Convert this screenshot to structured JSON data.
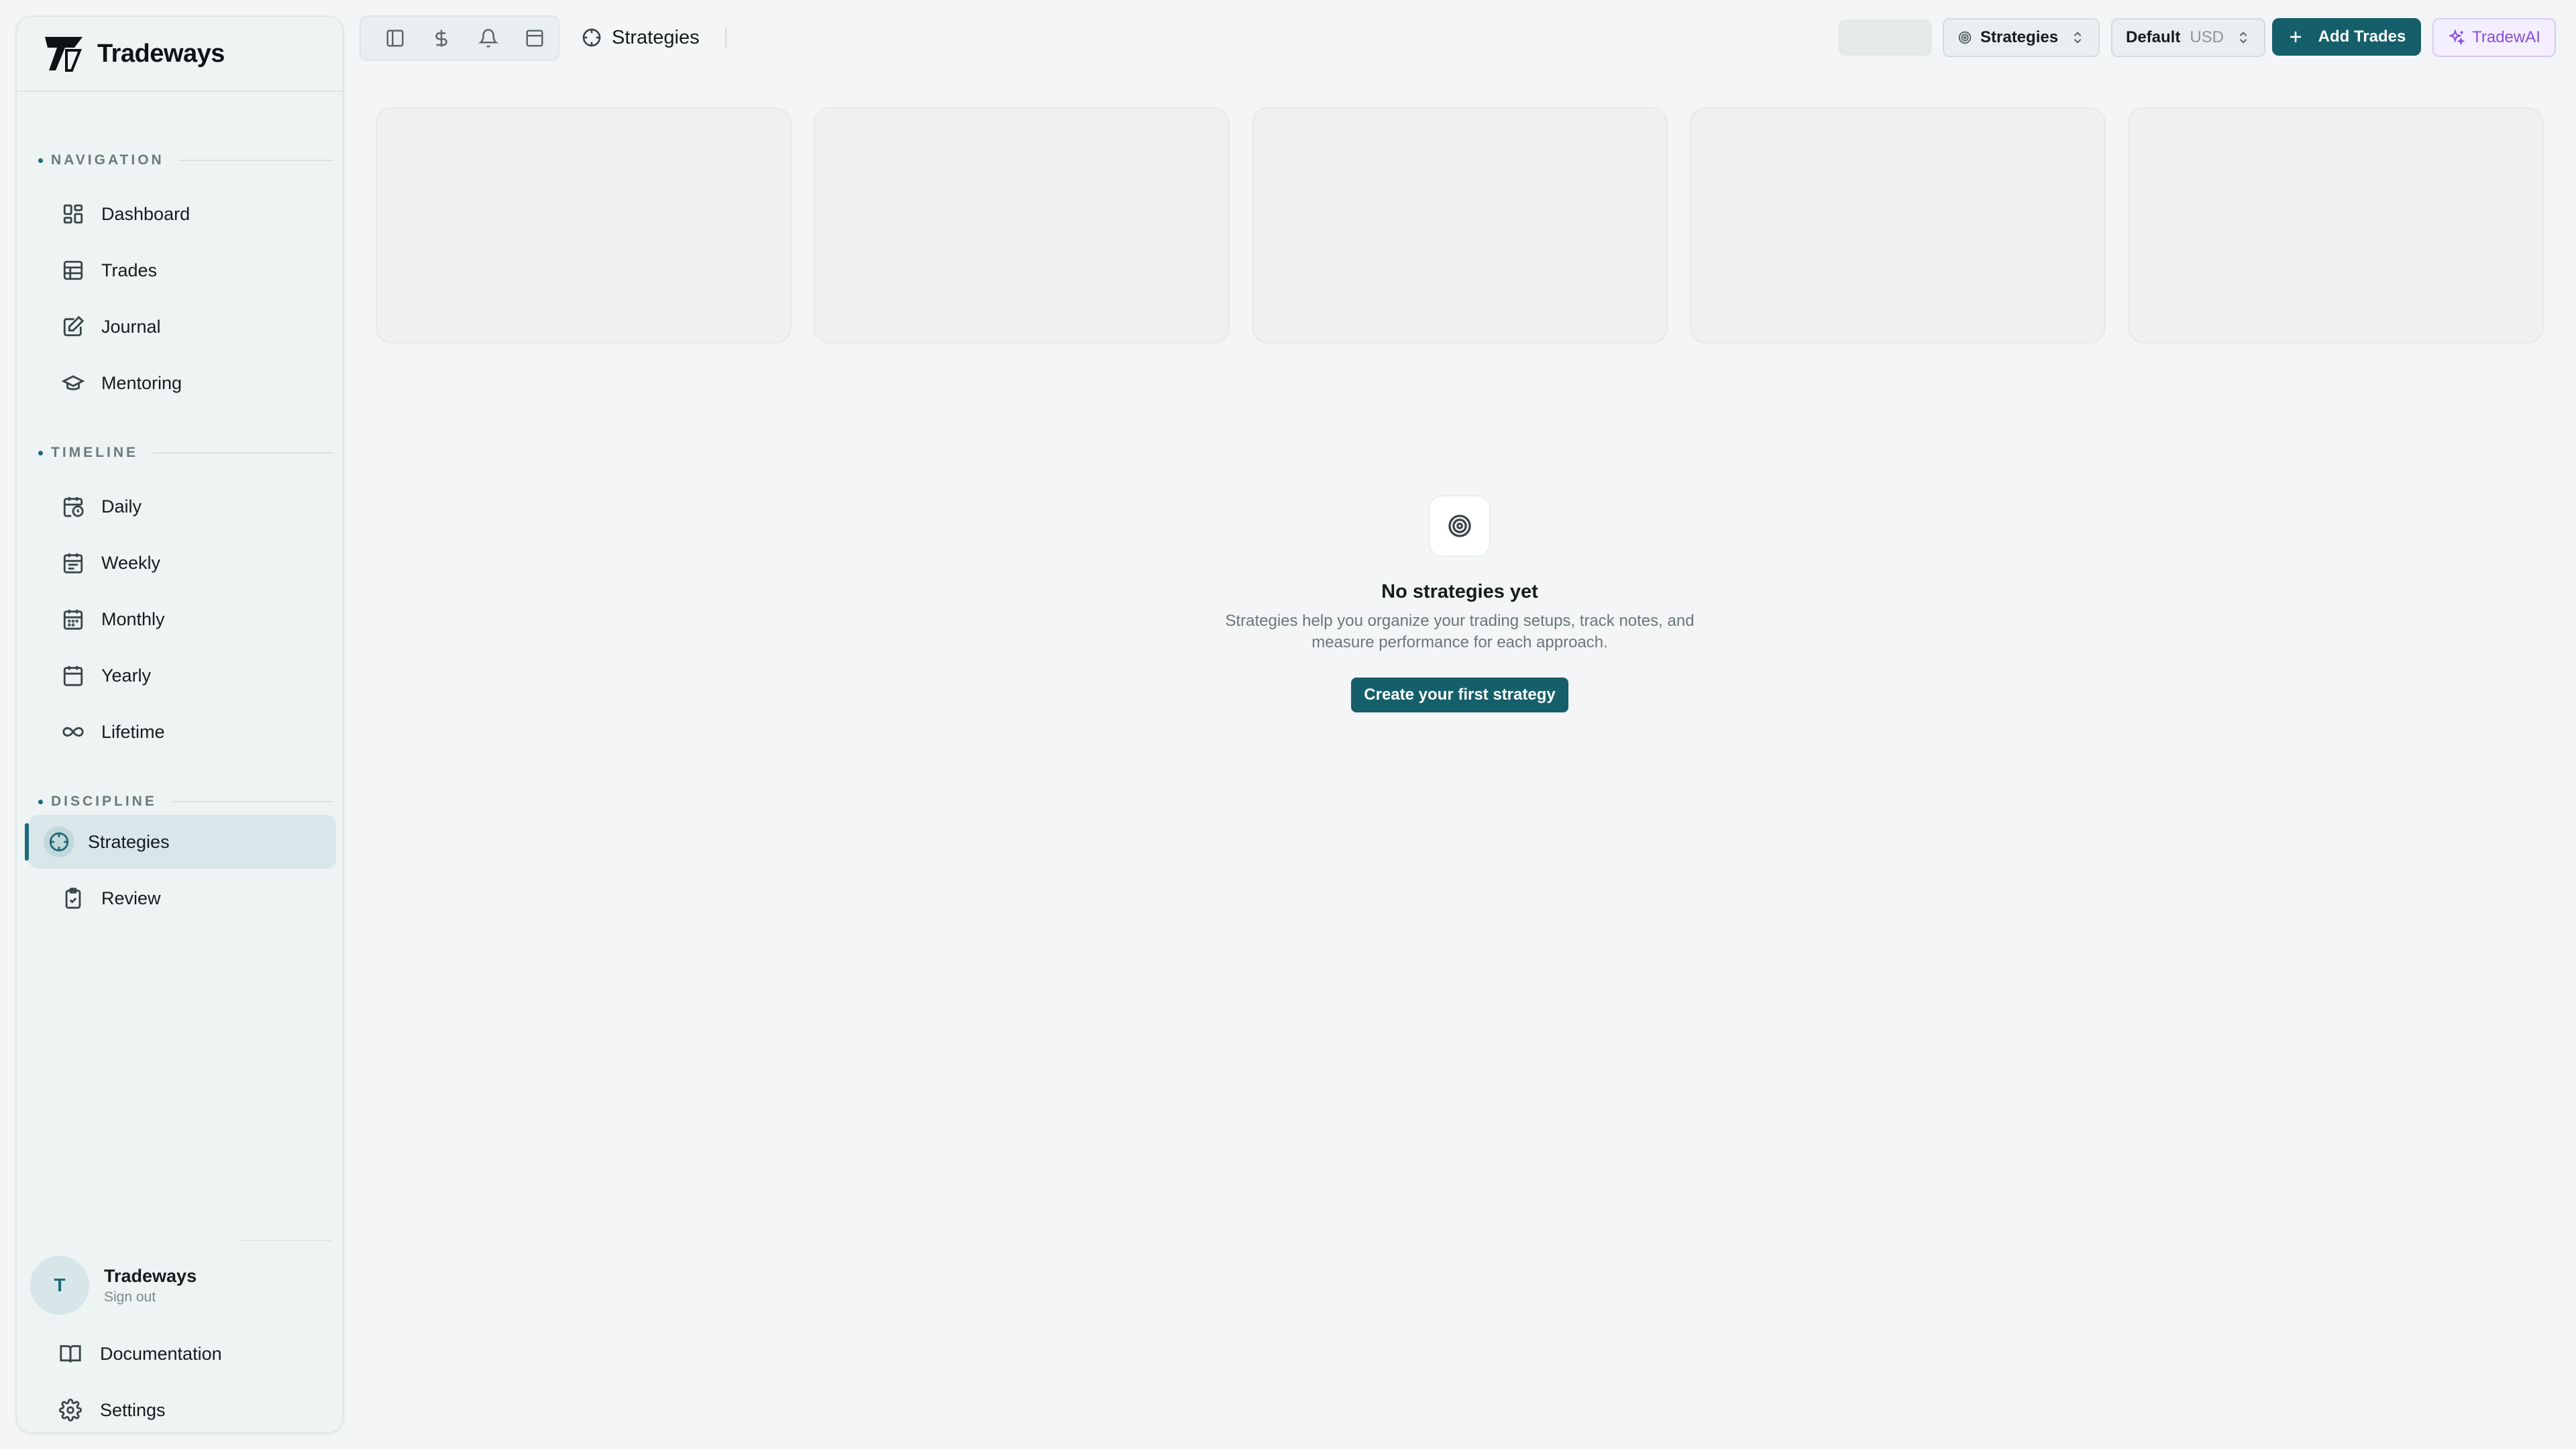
{
  "brand": {
    "name": "Tradeways"
  },
  "sidebar": {
    "sections": [
      {
        "label": "NAVIGATION"
      },
      {
        "label": "TIMELINE"
      },
      {
        "label": "DISCIPLINE"
      }
    ],
    "items": [
      {
        "label": "Dashboard",
        "icon": "dashboard-icon"
      },
      {
        "label": "Trades",
        "icon": "table-icon"
      },
      {
        "label": "Journal",
        "icon": "journal-icon"
      },
      {
        "label": "Mentoring",
        "icon": "graduation-cap-icon"
      },
      {
        "label": "Daily",
        "icon": "calendar-clock-icon"
      },
      {
        "label": "Weekly",
        "icon": "calendar-week-icon"
      },
      {
        "label": "Monthly",
        "icon": "calendar-month-icon"
      },
      {
        "label": "Yearly",
        "icon": "calendar-icon"
      },
      {
        "label": "Lifetime",
        "icon": "infinity-icon"
      },
      {
        "label": "Strategies",
        "icon": "crosshair-icon",
        "active": true
      },
      {
        "label": "Review",
        "icon": "clipboard-check-icon"
      }
    ],
    "profile": {
      "initial": "T",
      "name": "Tradeways",
      "sub": "Sign out"
    },
    "footer": [
      {
        "label": "Documentation",
        "icon": "book-icon"
      },
      {
        "label": "Settings",
        "icon": "gear-icon"
      }
    ]
  },
  "header": {
    "tools": [
      "sidebar-toggle-icon",
      "dollar-icon",
      "bell-icon",
      "layout-icon"
    ],
    "title": "Strategies",
    "strategy_select": "Strategies",
    "account_select": {
      "label": "Default",
      "currency": "USD"
    },
    "add_trades": "Add Trades",
    "ai": "TradewAI"
  },
  "empty_state": {
    "title": "No strategies yet",
    "description": "Strategies help you organize your trading setups, track notes, and measure performance for each approach.",
    "cta": "Create your first strategy"
  },
  "colors": {
    "accent": "#155f6b",
    "ai": "#8a4fd8",
    "background": "#f3f5f6",
    "sidebar": "#eef3f4"
  }
}
